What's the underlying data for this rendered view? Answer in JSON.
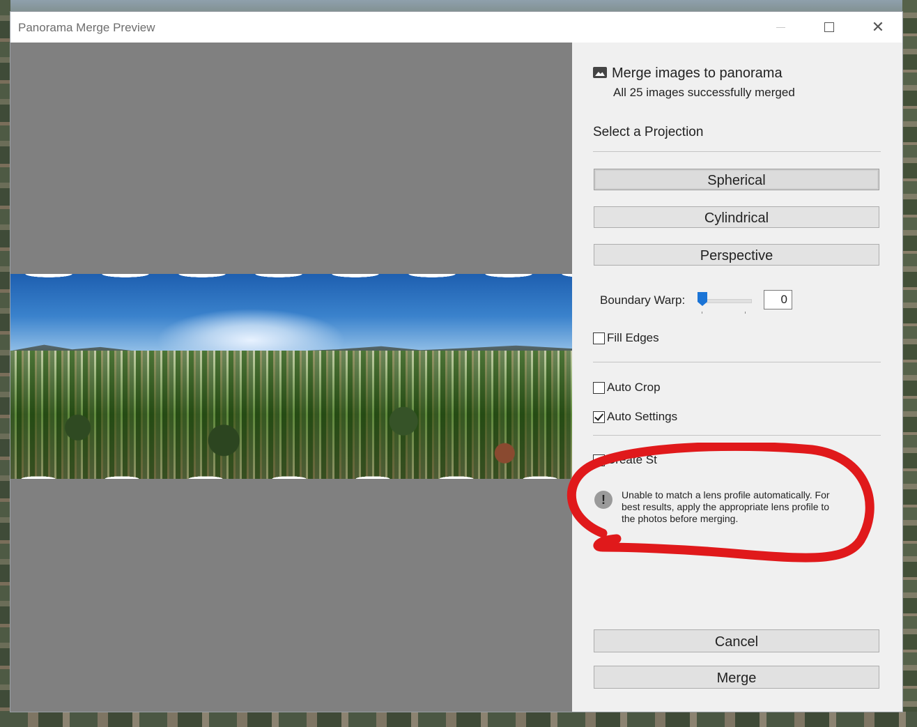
{
  "window": {
    "title": "Panorama Merge Preview"
  },
  "panel": {
    "heading": "Merge images to panorama",
    "subheading": "All 25 images successfully merged",
    "projection_label": "Select a Projection",
    "projections": [
      {
        "label": "Spherical",
        "selected": true
      },
      {
        "label": "Cylindrical",
        "selected": false
      },
      {
        "label": "Perspective",
        "selected": false
      }
    ],
    "boundary_warp": {
      "label": "Boundary Warp:",
      "value": "0"
    },
    "fill_edges": {
      "label": "Fill Edges",
      "checked": false
    },
    "auto_crop": {
      "label": "Auto Crop",
      "checked": false
    },
    "auto_settings": {
      "label": "Auto Settings",
      "checked": true
    },
    "create_stack": {
      "label": "Create St",
      "checked": false
    },
    "warning": {
      "icon": "exclamation-icon",
      "text": "Unable to match a lens profile automatically. For best results, apply the appropriate lens profile to the photos before merging."
    },
    "cancel_label": "Cancel",
    "merge_label": "Merge"
  },
  "annotation_color": "#e0191b"
}
